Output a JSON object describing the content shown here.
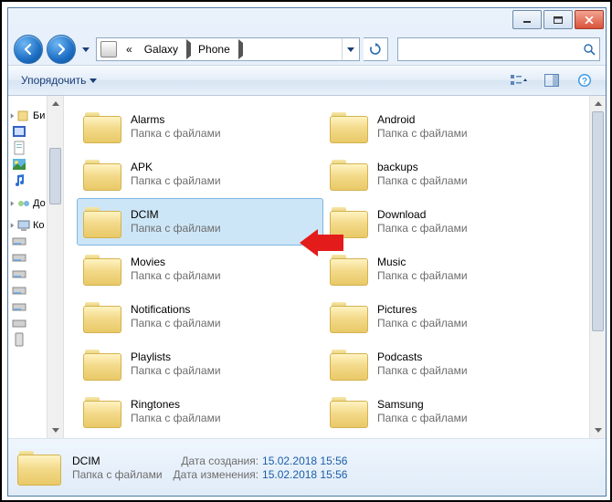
{
  "breadcrumb": [
    "Galaxy",
    "Phone"
  ],
  "search": {
    "placeholder": ""
  },
  "toolbar": {
    "organize": "Упорядочить"
  },
  "sidebar": {
    "libraries": "Би",
    "homegroup": "До",
    "computer": "Ко"
  },
  "folder_subtitle": "Папка с файлами",
  "folders_left": [
    {
      "name": "Alarms",
      "selected": false
    },
    {
      "name": "APK",
      "selected": false
    },
    {
      "name": "DCIM",
      "selected": true
    },
    {
      "name": "Movies",
      "selected": false
    },
    {
      "name": "Notifications",
      "selected": false
    },
    {
      "name": "Playlists",
      "selected": false
    },
    {
      "name": "Ringtones",
      "selected": false
    }
  ],
  "folders_right": [
    {
      "name": "Android",
      "selected": false
    },
    {
      "name": "backups",
      "selected": false
    },
    {
      "name": "Download",
      "selected": false
    },
    {
      "name": "Music",
      "selected": false
    },
    {
      "name": "Pictures",
      "selected": false
    },
    {
      "name": "Podcasts",
      "selected": false
    },
    {
      "name": "Samsung",
      "selected": false
    }
  ],
  "details": {
    "name": "DCIM",
    "type": "Папка с файлами",
    "created_label": "Дата создания:",
    "created": "15.02.2018 15:56",
    "modified_label": "Дата изменения:",
    "modified": "15.02.2018 15:56"
  }
}
